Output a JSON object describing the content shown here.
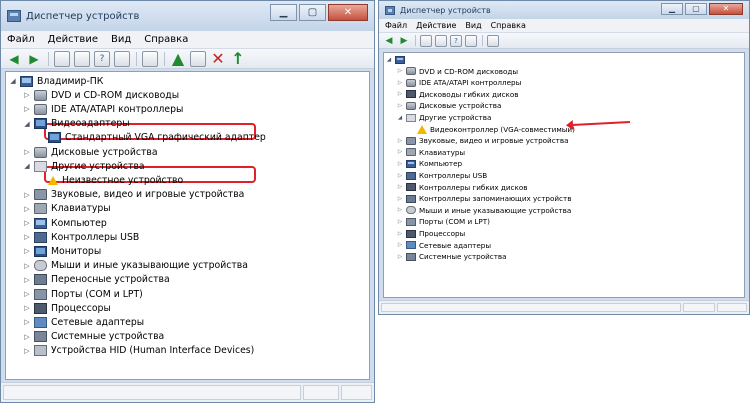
{
  "left": {
    "title": "Диспетчер устройств",
    "menu": [
      "Файл",
      "Действие",
      "Вид",
      "Справка"
    ],
    "tree": [
      {
        "label": "Владимир-ПК",
        "level": 0,
        "expander": "◢",
        "icon": "computer-icon"
      },
      {
        "label": "DVD и CD-ROM дисководы",
        "level": 1,
        "expander": "▷",
        "icon": "dvd-drive-icon"
      },
      {
        "label": "IDE ATA/ATAPI контроллеры",
        "level": 1,
        "expander": "▷",
        "icon": "ide-controller-icon"
      },
      {
        "label": "Видеоадаптеры",
        "level": 1,
        "expander": "◢",
        "icon": "display-adapter-icon"
      },
      {
        "label": "Стандартный VGA графический адаптер",
        "level": 2,
        "expander": "",
        "icon": "vga-adapter-icon"
      },
      {
        "label": "Дисковые устройства",
        "level": 1,
        "expander": "▷",
        "icon": "disk-drive-icon"
      },
      {
        "label": "Другие устройства",
        "level": 1,
        "expander": "◢",
        "icon": "other-devices-icon"
      },
      {
        "label": "Неизвестное устройство",
        "level": 2,
        "expander": "",
        "icon": "warning-icon"
      },
      {
        "label": "Звуковые, видео и игровые устройства",
        "level": 1,
        "expander": "▷",
        "icon": "sound-icon"
      },
      {
        "label": "Клавиатуры",
        "level": 1,
        "expander": "▷",
        "icon": "keyboard-icon"
      },
      {
        "label": "Компьютер",
        "level": 1,
        "expander": "▷",
        "icon": "computer-icon"
      },
      {
        "label": "Контроллеры USB",
        "level": 1,
        "expander": "▷",
        "icon": "usb-icon"
      },
      {
        "label": "Мониторы",
        "level": 1,
        "expander": "▷",
        "icon": "monitor-icon"
      },
      {
        "label": "Мыши и иные указывающие устройства",
        "level": 1,
        "expander": "▷",
        "icon": "mouse-icon"
      },
      {
        "label": "Переносные устройства",
        "level": 1,
        "expander": "▷",
        "icon": "portable-device-icon"
      },
      {
        "label": "Порты (COM и LPT)",
        "level": 1,
        "expander": "▷",
        "icon": "port-icon"
      },
      {
        "label": "Процессоры",
        "level": 1,
        "expander": "▷",
        "icon": "cpu-icon"
      },
      {
        "label": "Сетевые адаптеры",
        "level": 1,
        "expander": "▷",
        "icon": "network-adapter-icon"
      },
      {
        "label": "Системные устройства",
        "level": 1,
        "expander": "▷",
        "icon": "system-device-icon"
      },
      {
        "label": "Устройства HID (Human Interface Devices)",
        "level": 1,
        "expander": "▷",
        "icon": "hid-icon"
      }
    ]
  },
  "right": {
    "title": "Диспетчер устройств",
    "menu": [
      "Файл",
      "Действие",
      "Вид",
      "Справка"
    ],
    "tree": [
      {
        "label": "",
        "level": 0,
        "expander": "◢",
        "icon": "computer-icon"
      },
      {
        "label": "DVD и CD-ROM дисководы",
        "level": 1,
        "expander": "▷",
        "icon": "dvd-drive-icon"
      },
      {
        "label": "IDE ATA/ATAPI контроллеры",
        "level": 1,
        "expander": "▷",
        "icon": "ide-controller-icon"
      },
      {
        "label": "Дисководы гибких дисков",
        "level": 1,
        "expander": "▷",
        "icon": "floppy-icon"
      },
      {
        "label": "Дисковые устройства",
        "level": 1,
        "expander": "▷",
        "icon": "disk-drive-icon"
      },
      {
        "label": "Другие устройства",
        "level": 1,
        "expander": "◢",
        "icon": "other-devices-icon"
      },
      {
        "label": "Видеоконтроллер (VGA-совместимый)",
        "level": 2,
        "expander": "",
        "icon": "warning-icon"
      },
      {
        "label": "Звуковые, видео и игровые устройства",
        "level": 1,
        "expander": "▷",
        "icon": "sound-icon"
      },
      {
        "label": "Клавиатуры",
        "level": 1,
        "expander": "▷",
        "icon": "keyboard-icon"
      },
      {
        "label": "Компьютер",
        "level": 1,
        "expander": "▷",
        "icon": "computer-icon"
      },
      {
        "label": "Контроллеры USB",
        "level": 1,
        "expander": "▷",
        "icon": "usb-icon"
      },
      {
        "label": "Контроллеры гибких дисков",
        "level": 1,
        "expander": "▷",
        "icon": "floppy-controller-icon"
      },
      {
        "label": "Контроллеры запоминающих устройств",
        "level": 1,
        "expander": "▷",
        "icon": "storage-controller-icon"
      },
      {
        "label": "Мыши и иные указывающие устройства",
        "level": 1,
        "expander": "▷",
        "icon": "mouse-icon"
      },
      {
        "label": "Порты (COM и LPT)",
        "level": 1,
        "expander": "▷",
        "icon": "port-icon"
      },
      {
        "label": "Процессоры",
        "level": 1,
        "expander": "▷",
        "icon": "cpu-icon"
      },
      {
        "label": "Сетевые адаптеры",
        "level": 1,
        "expander": "▷",
        "icon": "network-adapter-icon"
      },
      {
        "label": "Системные устройства",
        "level": 1,
        "expander": "▷",
        "icon": "system-device-icon"
      }
    ]
  },
  "colors": {
    "highlight": "#e0202a",
    "window_frame": "#cfddee",
    "warning": "#f2b800"
  }
}
